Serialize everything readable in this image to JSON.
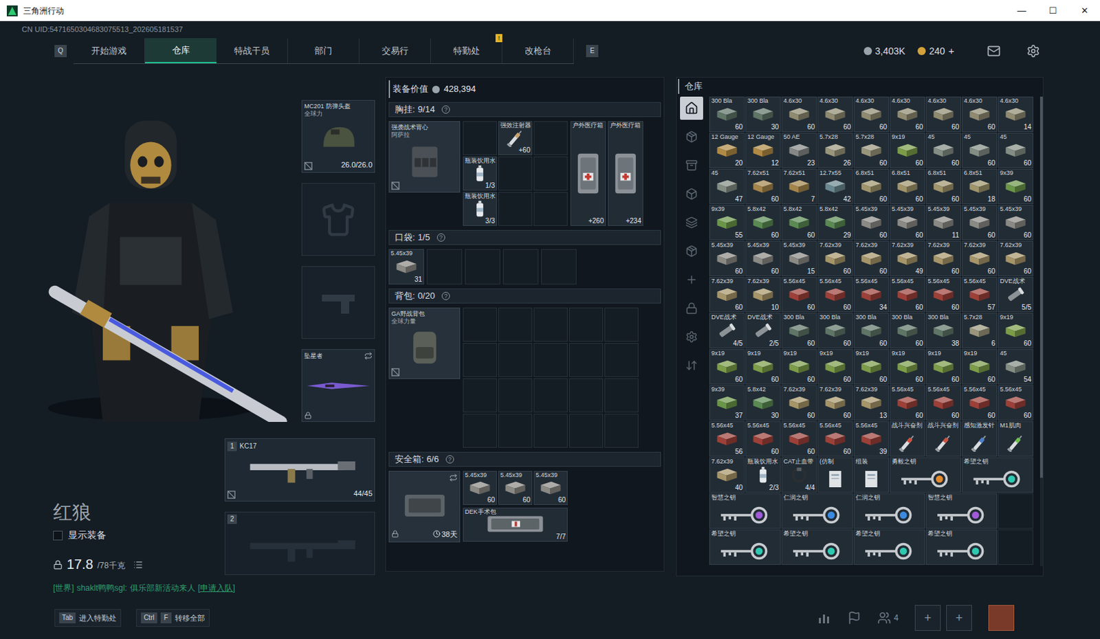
{
  "window": {
    "title": "三角洲行动",
    "controls": [
      "—",
      "☐",
      "✕"
    ]
  },
  "uid": "CN UID:5471650304683075513_202605181537",
  "nav": {
    "left_key": "Q",
    "right_key": "E",
    "notice": "!",
    "tabs": [
      {
        "label": "开始游戏",
        "selected": false
      },
      {
        "label": "仓库",
        "selected": true
      },
      {
        "label": "特战干员",
        "selected": false
      },
      {
        "label": "部门",
        "selected": false
      },
      {
        "label": "交易行",
        "selected": false
      },
      {
        "label": "特勤处",
        "selected": false
      },
      {
        "label": "改枪台",
        "selected": false
      }
    ]
  },
  "currency": [
    {
      "value": "3,403K",
      "color": "#9aa4ad",
      "add": ""
    },
    {
      "value": "240",
      "color": "#d4a23a",
      "add": "+"
    }
  ],
  "operator": {
    "name": "红狼",
    "show_gear": {
      "label": "显示装备",
      "checked": false
    },
    "weight": "17.8",
    "weight_max": "/78千克"
  },
  "chat": {
    "channel": "[世界]",
    "sender": "shaklt鸭鸭sgl:",
    "message": "俱乐部新活动来人",
    "link": "[申请入队]"
  },
  "hotkeys": [
    {
      "keys": [
        "Tab"
      ],
      "label": "进入特勤处"
    },
    {
      "keys": [
        "Ctrl",
        "F"
      ],
      "label": "转移全部"
    }
  ],
  "equipment": {
    "helmet": {
      "name": "MC201 防弹头盔",
      "sub": "全球力",
      "durability": "26.0/26.0"
    },
    "melee": {
      "name": "坠星者"
    },
    "weapons": [
      {
        "slot": "1",
        "name": "KC17",
        "ammo": "44/45",
        "empty": false
      },
      {
        "slot": "2",
        "name": "",
        "ammo": "",
        "empty": true
      }
    ]
  },
  "loadout": {
    "value_label": "装备价值",
    "value": "428,394",
    "rig": {
      "label": "胸挂:",
      "count": "9/14",
      "help": "?",
      "item": {
        "name": "强袭战术背心",
        "sub": "阿萨拉"
      },
      "slots": [
        {
          "kind": "empty"
        },
        {
          "kind": "syringe",
          "label": "强效注射器",
          "count": "+60",
          "color": "#c9a36a"
        },
        {
          "kind": "empty"
        },
        {
          "kind": "bottle",
          "label": "瓶装饮用水",
          "count": "1/3"
        },
        {
          "kind": "empty"
        },
        {
          "kind": "empty"
        },
        {
          "kind": "bottle",
          "label": "瓶装饮用水",
          "count": "3/3"
        },
        {
          "kind": "empty"
        },
        {
          "kind": "empty"
        }
      ],
      "medkits": [
        {
          "kind": "medkit",
          "label": "户外医疗箱",
          "count": "+260"
        },
        {
          "kind": "medkit",
          "label": "户外医疗箱",
          "count": "+234"
        }
      ]
    },
    "pocket": {
      "label": "口袋:",
      "count": "1/5",
      "help": "?",
      "slots": [
        {
          "kind": "ammo",
          "label": "5.45x39",
          "count": "31",
          "color": "#8a8984"
        },
        {
          "kind": "empty"
        },
        {
          "kind": "empty"
        },
        {
          "kind": "empty"
        },
        {
          "kind": "empty"
        }
      ]
    },
    "backpack": {
      "label": "背包:",
      "count": "0/20",
      "help": "?",
      "item": {
        "name": "GA野战背包",
        "sub": "全球力量"
      }
    },
    "safe": {
      "label": "安全箱:",
      "count": "6/6",
      "help": "?",
      "timer": "38天",
      "slots": [
        {
          "kind": "ammo",
          "label": "5.45x39",
          "count": "60",
          "color": "#8a8984"
        },
        {
          "kind": "ammo",
          "label": "5.45x39",
          "count": "60",
          "color": "#8a8984"
        },
        {
          "kind": "ammo",
          "label": "5.45x39",
          "count": "60",
          "color": "#8a8984"
        },
        {
          "kind": "surgery",
          "label": "DEK手术包",
          "count": "7/7"
        }
      ]
    }
  },
  "warehouse": {
    "title": "仓库",
    "side_icons": [
      {
        "selected": true
      },
      {
        "selected": false
      },
      {
        "selected": false
      },
      {
        "selected": false
      },
      {
        "selected": false
      },
      {
        "selected": false
      },
      {
        "selected": false
      },
      {
        "selected": false
      },
      {
        "selected": false
      },
      {
        "selected": false
      }
    ],
    "items": [
      {
        "kind": "ammo",
        "label": "300 Bla",
        "count": "60",
        "color": "#5f7566"
      },
      {
        "kind": "ammo",
        "label": "300 Bla",
        "count": "30",
        "color": "#5f7566"
      },
      {
        "kind": "ammo",
        "label": "4.6x30",
        "count": "60",
        "color": "#8f8a70"
      },
      {
        "kind": "ammo",
        "label": "4.6x30",
        "count": "60",
        "color": "#8f8a70"
      },
      {
        "kind": "ammo",
        "label": "4.6x30",
        "count": "60",
        "color": "#8f8a70"
      },
      {
        "kind": "ammo",
        "label": "4.6x30",
        "count": "60",
        "color": "#8f8a70"
      },
      {
        "kind": "ammo",
        "label": "4.6x30",
        "count": "60",
        "color": "#8f8a70"
      },
      {
        "kind": "ammo",
        "label": "4.6x30",
        "count": "60",
        "color": "#8f8a70"
      },
      {
        "kind": "ammo",
        "label": "4.6x30",
        "count": "14",
        "color": "#8f8a70"
      },
      {
        "kind": "ammo",
        "label": "12 Gauge",
        "count": "20",
        "color": "#b08a44"
      },
      {
        "kind": "ammo",
        "label": "12 Gauge",
        "count": "12",
        "color": "#b08a44"
      },
      {
        "kind": "ammo",
        "label": "50 AE",
        "count": "23",
        "color": "#858886"
      },
      {
        "kind": "ammo",
        "label": "5.7x28",
        "count": "26",
        "color": "#9a967c"
      },
      {
        "kind": "ammo",
        "label": "5.7x28",
        "count": "60",
        "color": "#9a967c"
      },
      {
        "kind": "ammo",
        "label": "9x19",
        "count": "60",
        "color": "#7c9c48"
      },
      {
        "kind": "ammo",
        "label": "45",
        "count": "60",
        "color": "#838d83"
      },
      {
        "kind": "ammo",
        "label": "45",
        "count": "60",
        "color": "#838d83"
      },
      {
        "kind": "ammo",
        "label": "45",
        "count": "60",
        "color": "#838d83"
      },
      {
        "kind": "ammo",
        "label": "45",
        "count": "47",
        "color": "#838d83"
      },
      {
        "kind": "ammo",
        "label": "7.62x51",
        "count": "60",
        "color": "#a4844a"
      },
      {
        "kind": "ammo",
        "label": "7.62x51",
        "count": "7",
        "color": "#a4844a"
      },
      {
        "kind": "ammo",
        "label": "12.7x55",
        "count": "42",
        "color": "#6a8890"
      },
      {
        "kind": "ammo",
        "label": "6.8x51",
        "count": "60",
        "color": "#a0946a"
      },
      {
        "kind": "ammo",
        "label": "6.8x51",
        "count": "60",
        "color": "#a0946a"
      },
      {
        "kind": "ammo",
        "label": "6.8x51",
        "count": "60",
        "color": "#a0946a"
      },
      {
        "kind": "ammo",
        "label": "6.8x51",
        "count": "18",
        "color": "#a0946a"
      },
      {
        "kind": "ammo",
        "label": "9x39",
        "count": "60",
        "color": "#6a9648"
      },
      {
        "kind": "ammo",
        "label": "9x39",
        "count": "55",
        "color": "#6a9648"
      },
      {
        "kind": "ammo",
        "label": "5.8x42",
        "count": "60",
        "color": "#5a8a52"
      },
      {
        "kind": "ammo",
        "label": "5.8x42",
        "count": "60",
        "color": "#5a8a52"
      },
      {
        "kind": "ammo",
        "label": "5.8x42",
        "count": "29",
        "color": "#5a8a52"
      },
      {
        "kind": "ammo",
        "label": "5.45x39",
        "count": "60",
        "color": "#8a8984"
      },
      {
        "kind": "ammo",
        "label": "5.45x39",
        "count": "60",
        "color": "#8a8984"
      },
      {
        "kind": "ammo",
        "label": "5.45x39",
        "count": "11",
        "color": "#8a8984"
      },
      {
        "kind": "ammo",
        "label": "5.45x39",
        "count": "60",
        "color": "#8a8984"
      },
      {
        "kind": "ammo",
        "label": "5.45x39",
        "count": "60",
        "color": "#8a8984"
      },
      {
        "kind": "ammo",
        "label": "5.45x39",
        "count": "60",
        "color": "#8a8984"
      },
      {
        "kind": "ammo",
        "label": "5.45x39",
        "count": "60",
        "color": "#8a8984"
      },
      {
        "kind": "ammo",
        "label": "5.45x39",
        "count": "15",
        "color": "#8a8984"
      },
      {
        "kind": "ammo",
        "label": "7.62x39",
        "count": "60",
        "color": "#a69568"
      },
      {
        "kind": "ammo",
        "label": "7.62x39",
        "count": "60",
        "color": "#a69568"
      },
      {
        "kind": "ammo",
        "label": "7.62x39",
        "count": "49",
        "color": "#a69568"
      },
      {
        "kind": "ammo",
        "label": "7.62x39",
        "count": "60",
        "color": "#a69568"
      },
      {
        "kind": "ammo",
        "label": "7.62x39",
        "count": "60",
        "color": "#a69568"
      },
      {
        "kind": "ammo",
        "label": "7.62x39",
        "count": "60",
        "color": "#a69568"
      },
      {
        "kind": "ammo",
        "label": "7.62x39",
        "count": "60",
        "color": "#a69568"
      },
      {
        "kind": "ammo",
        "label": "7.62x39",
        "count": "10",
        "color": "#a69568"
      },
      {
        "kind": "ammo",
        "label": "5.56x45",
        "count": "60",
        "color": "#9c4038"
      },
      {
        "kind": "ammo",
        "label": "5.56x45",
        "count": "60",
        "color": "#9c4038"
      },
      {
        "kind": "ammo",
        "label": "5.56x45",
        "count": "34",
        "color": "#9c4038"
      },
      {
        "kind": "ammo",
        "label": "5.56x45",
        "count": "60",
        "color": "#9c4038"
      },
      {
        "kind": "ammo",
        "label": "5.56x45",
        "count": "60",
        "color": "#9c4038"
      },
      {
        "kind": "ammo",
        "label": "5.56x45",
        "count": "57",
        "color": "#9c4038"
      },
      {
        "kind": "device",
        "label": "DVE战术",
        "count": "5/5",
        "color": "#8c9396"
      },
      {
        "kind": "device",
        "label": "DVE战术",
        "count": "4/5",
        "color": "#8c9396"
      },
      {
        "kind": "device",
        "label": "DVE战术",
        "count": "2/5",
        "color": "#8c9396"
      },
      {
        "kind": "ammo",
        "label": "300 Bla",
        "count": "60",
        "color": "#5f7566"
      },
      {
        "kind": "ammo",
        "label": "300 Bla",
        "count": "60",
        "color": "#5f7566"
      },
      {
        "kind": "ammo",
        "label": "300 Bla",
        "count": "60",
        "color": "#5f7566"
      },
      {
        "kind": "ammo",
        "label": "300 Bla",
        "count": "60",
        "color": "#5f7566"
      },
      {
        "kind": "ammo",
        "label": "300 Bla",
        "count": "38",
        "color": "#5f7566"
      },
      {
        "kind": "ammo",
        "label": "5.7x28",
        "count": "6",
        "color": "#9a967c"
      },
      {
        "kind": "ammo",
        "label": "9x19",
        "count": "60",
        "color": "#7c9c48"
      },
      {
        "kind": "ammo",
        "label": "9x19",
        "count": "60",
        "color": "#7c9c48"
      },
      {
        "kind": "ammo",
        "label": "9x19",
        "count": "60",
        "color": "#7c9c48"
      },
      {
        "kind": "ammo",
        "label": "9x19",
        "count": "60",
        "color": "#7c9c48"
      },
      {
        "kind": "ammo",
        "label": "9x19",
        "count": "60",
        "color": "#7c9c48"
      },
      {
        "kind": "ammo",
        "label": "9x19",
        "count": "60",
        "color": "#7c9c48"
      },
      {
        "kind": "ammo",
        "label": "9x19",
        "count": "60",
        "color": "#7c9c48"
      },
      {
        "kind": "ammo",
        "label": "9x19",
        "count": "60",
        "color": "#7c9c48"
      },
      {
        "kind": "ammo",
        "label": "9x19",
        "count": "60",
        "color": "#7c9c48"
      },
      {
        "kind": "ammo",
        "label": "45",
        "count": "54",
        "color": "#838d83"
      },
      {
        "kind": "ammo",
        "label": "9x39",
        "count": "37",
        "color": "#6a9648"
      },
      {
        "kind": "ammo",
        "label": "5.8x42",
        "count": "30",
        "color": "#5a8a52"
      },
      {
        "kind": "ammo",
        "label": "7.62x39",
        "count": "60",
        "color": "#a69568"
      },
      {
        "kind": "ammo",
        "label": "7.62x39",
        "count": "60",
        "color": "#a69568"
      },
      {
        "kind": "ammo",
        "label": "7.62x39",
        "count": "13",
        "color": "#a69568"
      },
      {
        "kind": "ammo",
        "label": "5.56x45",
        "count": "60",
        "color": "#9c4038"
      },
      {
        "kind": "ammo",
        "label": "5.56x45",
        "count": "60",
        "color": "#9c4038"
      },
      {
        "kind": "ammo",
        "label": "5.56x45",
        "count": "60",
        "color": "#9c4038"
      },
      {
        "kind": "ammo",
        "label": "5.56x45",
        "count": "60",
        "color": "#9c4038"
      },
      {
        "kind": "ammo",
        "label": "5.56x45",
        "count": "56",
        "color": "#9c4038"
      },
      {
        "kind": "ammo",
        "label": "5.56x45",
        "count": "60",
        "color": "#9c4038"
      },
      {
        "kind": "ammo",
        "label": "5.56x45",
        "count": "60",
        "color": "#9c4038"
      },
      {
        "kind": "ammo",
        "label": "5.56x45",
        "count": "60",
        "color": "#9c4038"
      },
      {
        "kind": "ammo",
        "label": "5.56x45",
        "count": "39",
        "color": "#9c4038"
      },
      {
        "kind": "syringe",
        "label": "战斗兴奋剂",
        "count": "",
        "color": "#d0503c"
      },
      {
        "kind": "syringe",
        "label": "战斗兴奋剂",
        "count": "",
        "color": "#d0503c"
      },
      {
        "kind": "syringe",
        "label": "感知激发针",
        "count": "",
        "color": "#4a7fd0"
      },
      {
        "kind": "syringe",
        "label": "M1肌肉",
        "count": "",
        "color": "#6cc04a"
      },
      {
        "kind": "ammo",
        "label": "7.62x39",
        "count": "40",
        "color": "#a69568"
      },
      {
        "kind": "bottle",
        "label": "瓶装饮用水",
        "count": "2/3"
      },
      {
        "kind": "tourniquet",
        "label": "CAT止血带",
        "count": "4/4"
      },
      {
        "kind": "doc",
        "label": "(仿制",
        "count": ""
      },
      {
        "kind": "doc",
        "label": "组装",
        "count": ""
      },
      {
        "kind": "key",
        "label": "勇毅之钥",
        "color": "#e08a2e"
      },
      {
        "kind": "key",
        "label": "希望之钥",
        "color": "#2ec9b0"
      },
      {
        "kind": "key",
        "label": "智慧之钥",
        "color": "#a05ad8"
      },
      {
        "kind": "key",
        "label": "仁润之钥",
        "color": "#3a8ae0"
      },
      {
        "kind": "key",
        "label": "仁润之钥",
        "color": "#3a8ae0"
      },
      {
        "kind": "key",
        "label": "智慧之钥",
        "color": "#a05ad8"
      },
      {
        "kind": "empty"
      },
      {
        "kind": "key",
        "label": "希望之钥",
        "color": "#2ec9b0"
      },
      {
        "kind": "key",
        "label": "希望之钥",
        "color": "#2ec9b0"
      },
      {
        "kind": "key",
        "label": "希望之钥",
        "color": "#2ec9b0"
      },
      {
        "kind": "key",
        "label": "希望之钥",
        "color": "#2ec9b0"
      },
      {
        "kind": "empty"
      }
    ]
  },
  "bottom_bar": {
    "party": "4",
    "slots": [
      "+",
      "+"
    ]
  }
}
